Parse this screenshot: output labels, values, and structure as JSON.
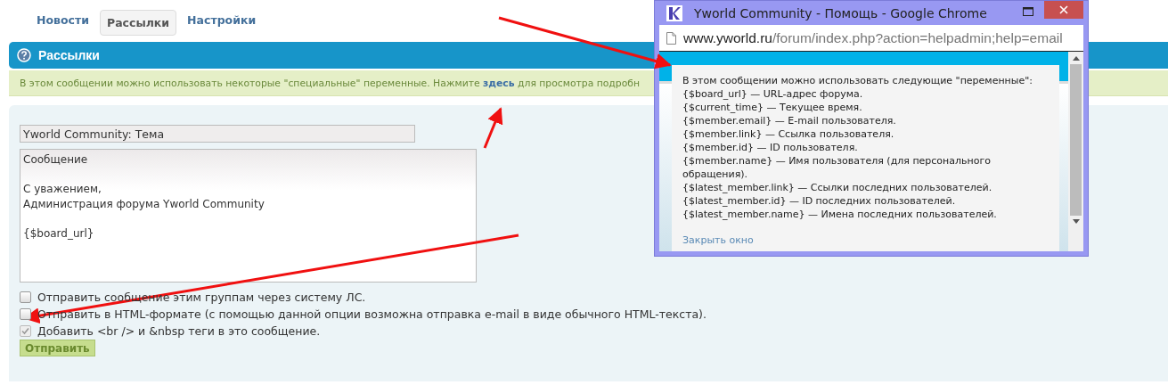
{
  "tabs": [
    {
      "label": "Новости",
      "selected": false
    },
    {
      "label": "Рассылки",
      "selected": true
    },
    {
      "label": "Настройки",
      "selected": false
    }
  ],
  "section": {
    "title": "Рассылки"
  },
  "notice": {
    "before": "В этом сообщении можно использовать некоторые \"специальные\" переменные. Нажмите",
    "link": "здесь",
    "after": "для просмотра подробн"
  },
  "form": {
    "subject": "Yworld Community: Тема",
    "message": "Сообщение\n\nС уважением,\nАдминистрация форума Yworld Community\n\n{$board_url}",
    "options": [
      {
        "label": "Отправить сообщение этим группам через систему ЛС.",
        "checked": false,
        "disabled": false
      },
      {
        "label": "Отправить в HTML-формате (с помощью данной опции возможна отправка e-mail в виде обычного HTML-текста).",
        "checked": false,
        "disabled": false
      },
      {
        "label": "Добавить <br /> и &nbsp теги в это сообщение.",
        "checked": true,
        "disabled": true
      }
    ],
    "submit": "Отправить"
  },
  "popup": {
    "window_title": "Yworld Community - Помощь - Google Chrome",
    "url_host": "www.yworld.ru",
    "url_path": "/forum/index.php?action=helpadmin;help=email",
    "lines": [
      "В этом сообщении можно использовать следующие \"переменные\":",
      "{$board_url} — URL-адрес форума.",
      "{$current_time} — Текущее время.",
      "{$member.email} — E-mail пользователя.",
      "{$member.link} — Ссылка пользователя.",
      "{$member.id} — ID пользователя.",
      "{$member.name} — Имя пользователя (для персонального обращения).",
      "{$latest_member.link} — Ссылки последних пользователей.",
      "{$latest_member.id} — ID последних пользователей.",
      "{$latest_member.name} — Имена последних пользователей."
    ],
    "close_link": "Закрыть окно"
  }
}
